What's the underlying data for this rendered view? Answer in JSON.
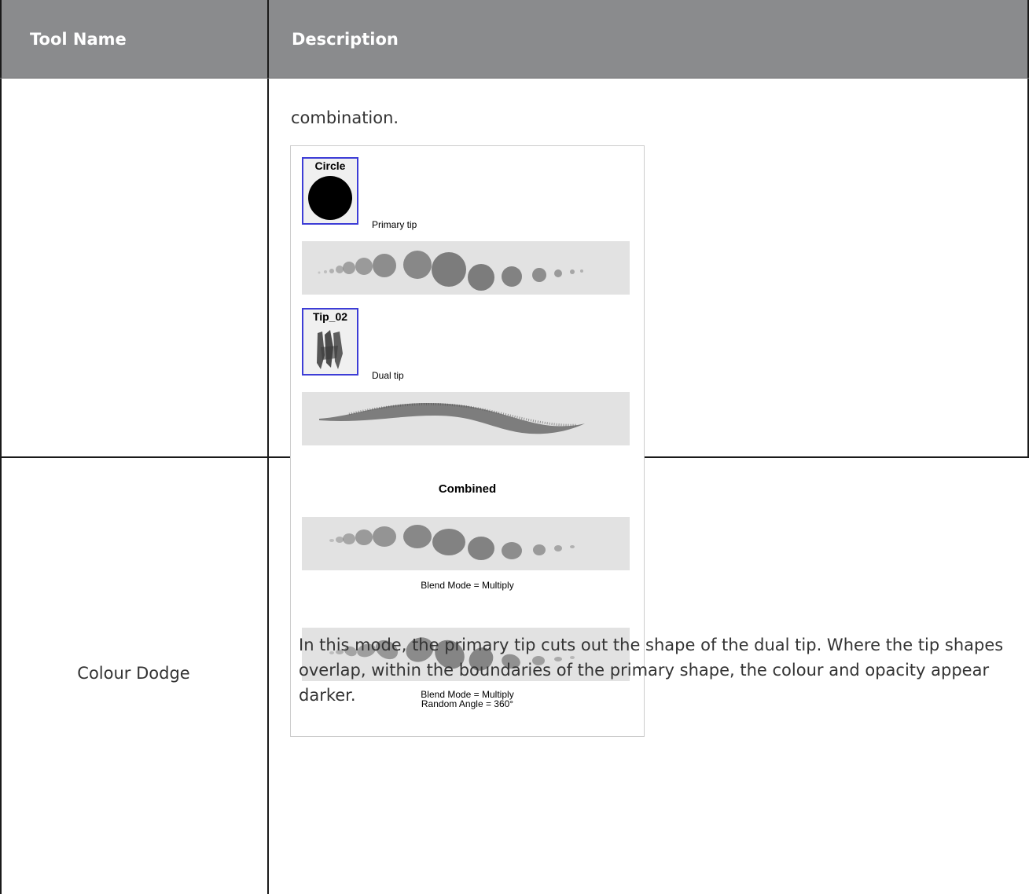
{
  "table": {
    "headers": [
      "Tool Name",
      "Description"
    ],
    "row1": {
      "tool_name": "",
      "description_text": "combination."
    },
    "row2": {
      "tool_name": "Colour Dodge",
      "description_lines": [
        "In this mode, the primary tip cuts out the shape of the dual tip. Where the tip shapes",
        "overlap, within the boundaries of the primary shape, the colour and opacity appear",
        "darker."
      ]
    }
  },
  "figure": {
    "primary_thumb_label": "Circle",
    "primary_caption": "Primary tip",
    "dual_thumb_label": "Tip_02",
    "dual_caption": "Dual tip",
    "combined_title": "Combined",
    "multiply_caption": "Blend Mode = Multiply",
    "random_caption_line1": "Blend Mode = Multiply",
    "random_caption_line2": "Random Angle = 360°"
  },
  "colors": {
    "header_bg": "#8a8b8d",
    "thumb_border": "#3d3dd6",
    "strip_bg": "#e2e2e2"
  }
}
